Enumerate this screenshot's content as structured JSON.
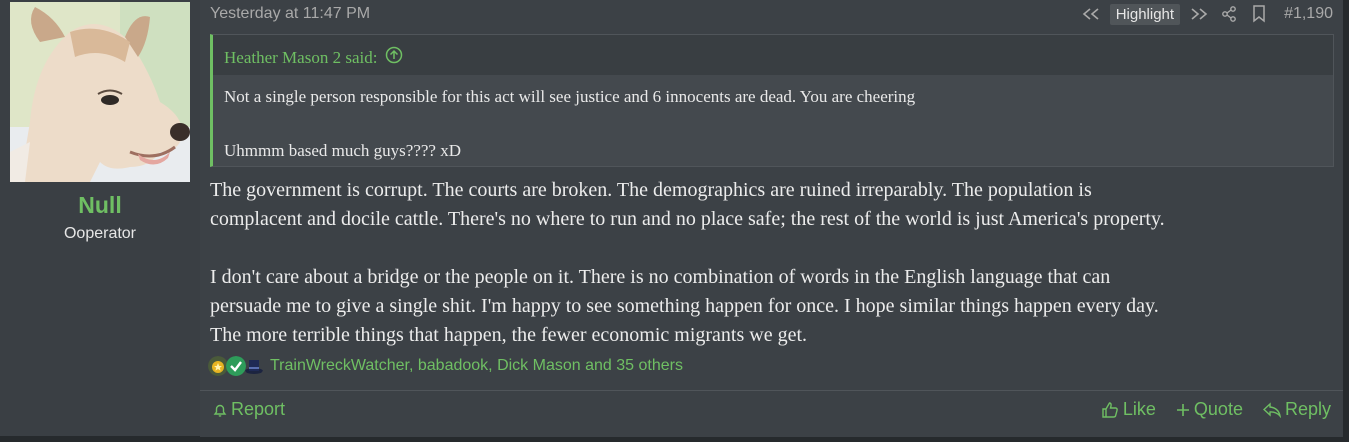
{
  "user": {
    "name": "Null",
    "title": "Ooperator",
    "avatar_icon": "dog-avatar"
  },
  "post": {
    "date": "Yesterday at 11:47 PM",
    "highlight_label": "Highlight",
    "post_number": "#1,190",
    "quote": {
      "author": "Heather Mason 2 said:",
      "lines": [
        "Not a single person responsible for this act will see justice and 6 innocents are dead. You are cheering",
        "Uhmmm based much guys???? xD"
      ]
    },
    "body": [
      "The government is corrupt. The courts are broken. The demographics are ruined irreparably. The population is",
      "complacent and docile cattle. There's no where to run and no place safe; the rest of the world is just America's property.",
      "I don't care about a bridge or the people on it. There is no combination of words in the English language that can",
      "persuade me to give a single shit. I'm happy to see something happen for once. I hope similar things happen every day.",
      "The more terrible things that happen, the fewer economic migrants we get."
    ],
    "reactions": {
      "icons": [
        "medal-icon",
        "checkmark-icon",
        "top-hat-icon"
      ],
      "users_text": "TrainWreckWatcher, babadook, Dick Mason and 35 others"
    }
  },
  "footer": {
    "report": "Report",
    "like": "Like",
    "quote": "Quote",
    "reply": "Reply"
  },
  "colors": {
    "accent": "#6fbf63",
    "background": "#3c4146",
    "text": "#ececec"
  }
}
